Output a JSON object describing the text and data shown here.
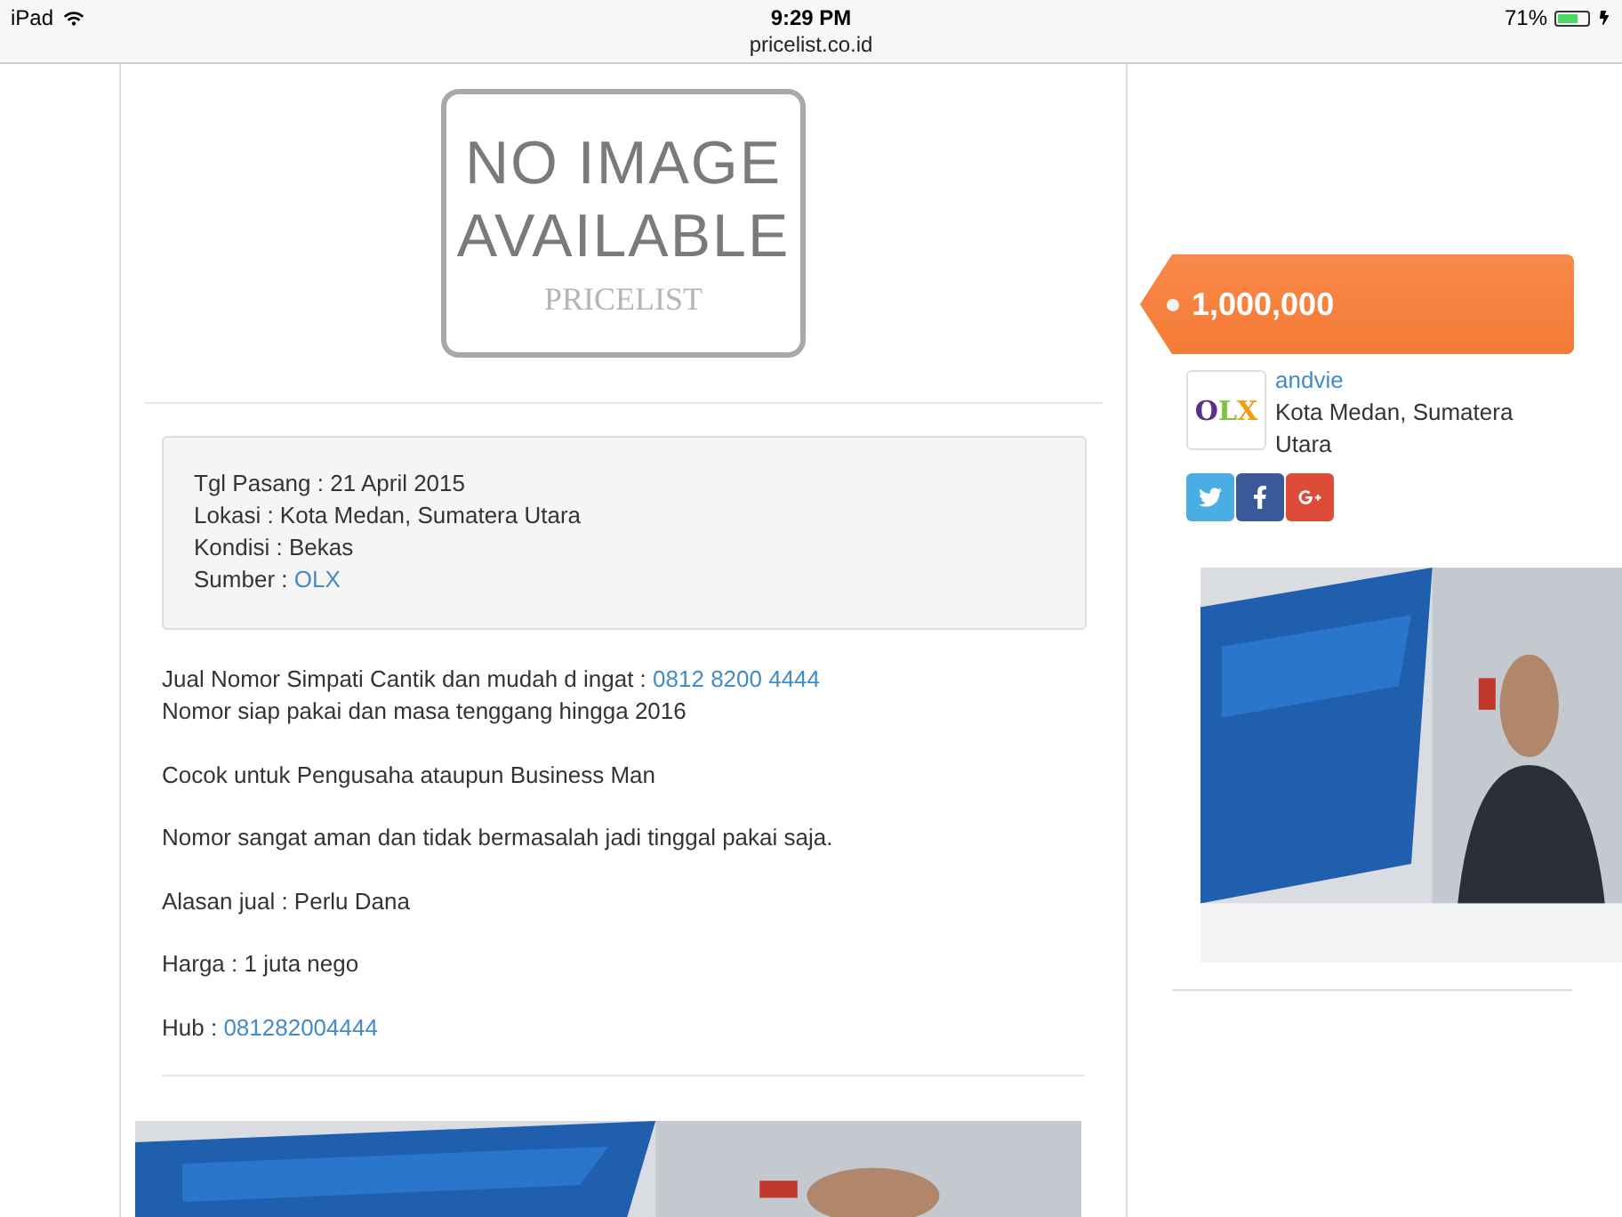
{
  "status_bar": {
    "device": "iPad",
    "time": "9:29 PM",
    "url": "pricelist.co.id",
    "battery": "71%",
    "charging": true
  },
  "placeholder_image": {
    "line_1": "NO IMAGE",
    "line_2": "AVAILABLE",
    "brand": "PRICELIST"
  },
  "details": [
    {
      "label": "Tgl Pasang : ",
      "value": "21 April 2015",
      "link": false
    },
    {
      "label": "Lokasi : ",
      "value": "Kota Medan, Sumatera Utara",
      "link": false
    },
    {
      "label": "Kondisi : ",
      "value": "Bekas",
      "link": false
    },
    {
      "label": "Sumber : ",
      "value": "OLX",
      "link": true
    }
  ],
  "description": [
    {
      "lines": [
        {
          "text": "Jual Nomor Simpati Cantik dan mudah d ingat : ",
          "link": "0812 8200 4444"
        },
        {
          "text": "Nomor siap pakai dan masa tenggang hingga 2016"
        }
      ]
    },
    {
      "lines": [
        {
          "text": "Cocok untuk Pengusaha ataupun Business Man"
        }
      ]
    },
    {
      "lines": [
        {
          "text": "Nomor sangat aman dan tidak bermasalah jadi tinggal pakai saja."
        }
      ]
    },
    {
      "lines": [
        {
          "text": "Alasan jual : Perlu Dana"
        }
      ]
    },
    {
      "lines": [
        {
          "text": "Harga : 1 juta nego"
        }
      ]
    },
    {
      "lines": [
        {
          "text": "Hub : ",
          "link": "081282004444"
        }
      ]
    }
  ],
  "price": "1,000,000",
  "seller": {
    "logo": [
      {
        "letter": "O",
        "color": "#5b2d8e"
      },
      {
        "letter": "L",
        "color": "#7cc242"
      },
      {
        "letter": "X",
        "color": "#f39c12"
      }
    ],
    "name": "andvie",
    "location": "Kota Medan, Sumatera Utara"
  },
  "share_buttons": [
    {
      "kind": "twitter",
      "color": "#4aaee4"
    },
    {
      "kind": "facebook",
      "color": "#3b5998"
    },
    {
      "kind": "googleplus",
      "color": "#dd4b39"
    }
  ]
}
